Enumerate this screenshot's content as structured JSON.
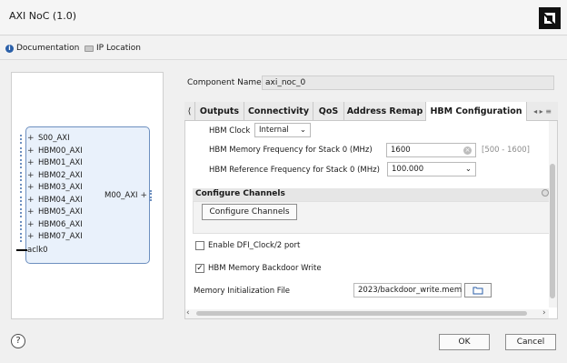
{
  "window": {
    "title": "AXI NoC (1.0)"
  },
  "toolbar": {
    "documentation_label": "Documentation",
    "ip_location_label": "IP Location"
  },
  "component": {
    "label": "Component Name",
    "value": "axi_noc_0"
  },
  "block": {
    "ports_left": [
      "S00_AXI",
      "HBM00_AXI",
      "HBM01_AXI",
      "HBM02_AXI",
      "HBM03_AXI",
      "HBM04_AXI",
      "HBM05_AXI",
      "HBM06_AXI",
      "HBM07_AXI"
    ],
    "clock": "aclk0",
    "port_right": "M00_AXI"
  },
  "tabs": {
    "scroll_left": "⟨",
    "labels": [
      "Outputs",
      "Connectivity",
      "QoS",
      "Address Remap",
      "HBM Configuration"
    ],
    "nav": "◂ ▸ ≡"
  },
  "hbm": {
    "clock_label": "HBM Clock",
    "clock_value": "Internal",
    "mem_freq_label": "HBM Memory Frequency for Stack 0 (MHz)",
    "mem_freq_value": "1600",
    "mem_freq_range": "[500 - 1600]",
    "ref_freq_label": "HBM Reference Frequency for Stack 0 (MHz)",
    "ref_freq_value": "100.000"
  },
  "channels": {
    "section_title": "Configure Channels",
    "button_label": "Configure Channels"
  },
  "options": {
    "dfi_label": "Enable DFI_Clock/2 port",
    "dfi_checked": false,
    "backdoor_label": "HBM Memory Backdoor Write",
    "backdoor_checked": true,
    "init_file_label": "Memory Initialization File",
    "init_file_value": "2023/backdoor_write.mem"
  },
  "footer": {
    "help": "?",
    "ok_label": "OK",
    "cancel_label": "Cancel"
  },
  "colors": {
    "accent": "#2a5fa8",
    "block_fill": "#e9f1fb",
    "block_border": "#6d8fbf"
  }
}
